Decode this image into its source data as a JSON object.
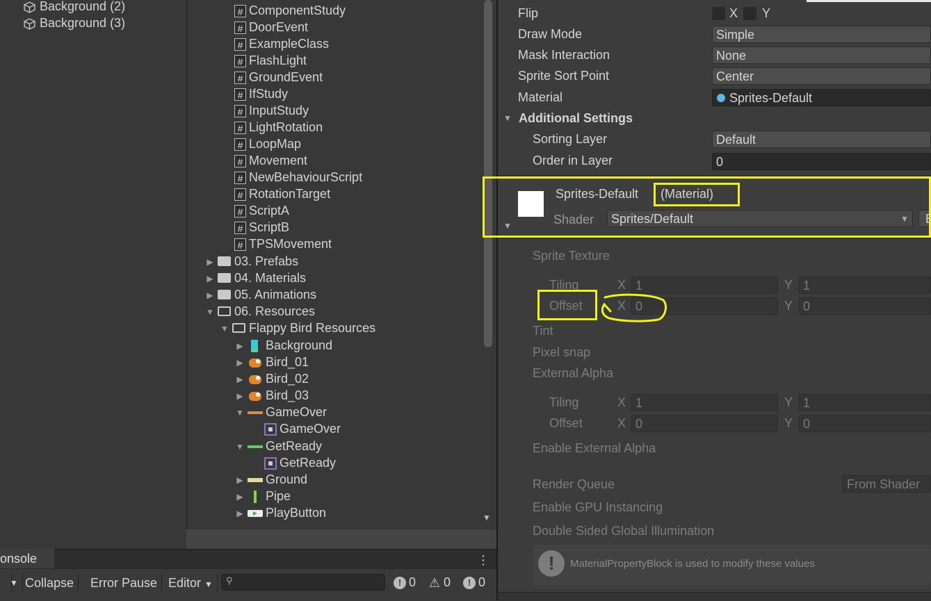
{
  "hierarchy": {
    "items": [
      "Background (2)",
      "Background (3)"
    ]
  },
  "project": {
    "scripts": [
      "ComponentStudy",
      "DoorEvent",
      "ExampleClass",
      "FlashLight",
      "GroundEvent",
      "IfStudy",
      "InputStudy",
      "LightRotation",
      "LoopMap",
      "Movement",
      "NewBehaviourScript",
      "RotationTarget",
      "ScriptA",
      "ScriptB",
      "TPSMovement"
    ],
    "folders": [
      "03. Prefabs",
      "04. Materials",
      "05. Animations",
      "06. Resources"
    ],
    "subfolder": "Flappy Bird Resources",
    "assets": [
      "Background",
      "Bird_01",
      "Bird_02",
      "Bird_03",
      "GameOver",
      "GameOver",
      "GetReady",
      "GetReady",
      "Ground",
      "Pipe",
      "PlayButton"
    ]
  },
  "console": {
    "tab_label": "onsole",
    "collapse": "Collapse",
    "error_pause": "Error Pause",
    "editor": "Editor",
    "counts": [
      "0",
      "0",
      "0"
    ]
  },
  "inspector": {
    "flip_label": "Flip",
    "flip_x": "X",
    "flip_y": "Y",
    "draw_mode_label": "Draw Mode",
    "draw_mode": "Simple",
    "mask_label": "Mask Interaction",
    "mask": "None",
    "sort_point_label": "Sprite Sort Point",
    "sort_point": "Center",
    "material_label": "Material",
    "material": "Sprites-Default",
    "additional_settings": "Additional Settings",
    "sorting_layer_label": "Sorting Layer",
    "sorting_layer": "Default",
    "order_label": "Order in Layer",
    "order": "0",
    "mat_name": "Sprites-Default",
    "mat_type": "(Material)",
    "shader_label": "Shader",
    "shader": "Sprites/Default",
    "edit_btn": "E",
    "sprite_texture": "Sprite Texture",
    "tiling_label": "Tiling",
    "offset_label": "Offset",
    "x": "X",
    "y": "Y",
    "tiling_x": "1",
    "tiling_y": "1",
    "offset_x": "0",
    "offset_y": "0",
    "tint": "Tint",
    "pixel_snap": "Pixel snap",
    "external_alpha": "External Alpha",
    "tiling2_label": "Tiling",
    "offset2_label": "Offset",
    "tiling2_x": "1",
    "tiling2_y": "1",
    "offset2_x": "0",
    "offset2_y": "0",
    "enable_ext_alpha": "Enable External Alpha",
    "render_queue_label": "Render Queue",
    "render_queue": "From Shader",
    "gpu_instancing": "Enable GPU Instancing",
    "double_sided": "Double Sided Global Illumination",
    "help_text": "MaterialPropertyBlock is used to modify these values"
  },
  "colors": {
    "highlight": "#f2f21a"
  }
}
